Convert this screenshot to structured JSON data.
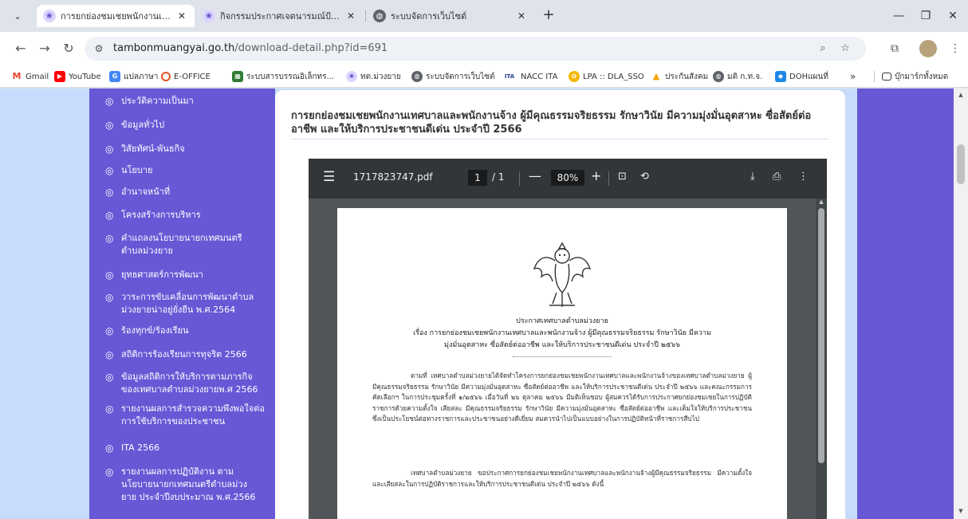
{
  "browser": {
    "tabs": [
      {
        "title": "การยกย่องชมเชยพนักงานเทศบาลและ",
        "active": true,
        "favicon": "seal-icon"
      },
      {
        "title": "กิจกรรมประกาศเจตนารมณ์ป้องกันแล",
        "active": false,
        "favicon": "seal-icon"
      },
      {
        "title": "ระบบจัดการเว็บไซต์",
        "active": false,
        "favicon": "globe-icon"
      }
    ],
    "url_domain": "tambonmuangyai.go.th",
    "url_path": "/download-detail.php?id=691",
    "bookmarks": [
      {
        "label": "Gmail",
        "icon": "gmail-icon"
      },
      {
        "label": "YouTube",
        "icon": "youtube-icon"
      },
      {
        "label": "แปลภาษา",
        "icon": "translate-icon"
      },
      {
        "label": "E-OFFICE",
        "icon": "ring-icon"
      },
      {
        "label": "ระบบสารบรรณอิเล็กทร...",
        "icon": "saraban-icon"
      },
      {
        "label": "ทต.ม่วงยาย",
        "icon": "seal-icon"
      },
      {
        "label": "ระบบจัดการเว็บไซต์",
        "icon": "globe-icon"
      },
      {
        "label": "NACC ITA",
        "icon": "ita-icon"
      },
      {
        "label": "LPA :: DLA_SSO",
        "icon": "lpa-icon"
      },
      {
        "label": "ประกันสังคม",
        "icon": "sso-icon"
      },
      {
        "label": "มติ ก.ท.จ.",
        "icon": "globe-icon"
      },
      {
        "label": "DOHแผนที่",
        "icon": "doh-icon"
      }
    ],
    "bookmarks_overflow": "»",
    "all_bookmarks": "บุ๊กมาร์กทั้งหมด"
  },
  "sidebar": {
    "items": [
      {
        "label": "ประวัติความเป็นมา"
      },
      {
        "label": "ข้อมูลทั่วไป"
      },
      {
        "label": "วิสัยทัศน์-พันธกิจ"
      },
      {
        "label": "นโยบาย"
      },
      {
        "label": "อำนาจหน้าที่"
      },
      {
        "label": "โครงสร้างการบริหาร"
      },
      {
        "label": "คำแถลงนโยบายนายกเทศมนตรีตำบลม่วงยาย"
      },
      {
        "label": "ยุทธศาสตร์การพัฒนา"
      },
      {
        "label": "วาระการขับเคลื่อนการพัฒนาตำบลม่วงยายน่าอยู่ยั่งยืน พ.ศ.2564"
      },
      {
        "label": "ร้องทุกข์/ร้องเรียน"
      },
      {
        "label": "สถิติการร้องเรียนการทุจริต 2566"
      },
      {
        "label": "ข้อมูลสถิติการให้บริการตามภารกิจของเทศบาลตำบลม่วงยายพ.ศ 2566"
      },
      {
        "label": "รายงานผลการสำรวจความพึงพอใจต่อการใช้บริการของประชาชน"
      },
      {
        "label": "ITA 2566"
      },
      {
        "label": "รายงานผลการปฏิบัติงาน ตามนโยบายนายกเทศมนตรีตำบลม่วงยาย ประจำปีงบประมาณ พ.ศ.2566"
      }
    ]
  },
  "content": {
    "title": "การยกย่องชมเชยพนักงานเทศบาลและพนักงานจ้าง ผู้มีคุณธรรมจริยธรรม รักษาวินัย มีความมุ่งมั่นอุตสาหะ ซื่อสัตย์ต่ออาชีพ และให้บริการประชาชนดีเด่น ประจำปี 2566"
  },
  "pdf": {
    "filename": "1717823747.pdf",
    "page_current": "1",
    "page_total": "/ 1",
    "zoom": "80%",
    "doc": {
      "issuer": "ประกาศเทศบาลตำบลม่วงยาย",
      "subject_line1": "เรื่อง  การยกย่องชมเชยพนักงานเทศบาลและพนักงานจ้าง ผู้มีคุณธรรมจริยธรรม รักษาวินัย มีความ",
      "subject_line2": "มุ่งมั่นอุตสาหะ ซื่อสัตย์ต่ออาชีพ และให้บริการประชาชนดีเด่น ประจำปี ๒๕๖๖",
      "para1": "ตามที่ เทศบาลตำบลม่วงยายได้จัดทำโครงการยกย่องชมเชยพนักงานเทศบาลและพนักงานจ้างของเทศบาลตำบลม่วงยาย ผู้มีคุณธรรมจริยธรรม รักษาวินัย มีความมุ่งมั่นอุตสาหะ ซื่อสัตย์ต่ออาชีพ และให้บริการประชาชนดีเด่น ประจำปี ๒๕๖๖ และคณะกรรมการคัดเลือกฯ ในการประชุมครั้งที่ ๑/๒๕๖๖ เมื่อวันที่ ๒๖ ตุลาคม ๒๕๖๖ มีมติเห็นชอบ ผู้สมควรได้รับการประกาศยกย่องชมเชยในการปฏิบัติราชการด้วยความตั้งใจ เสียสละ มีคุณธรรมจริยธรรม รักษาวินัย มีความมุ่งมั่นอุตสาหะ ซื่อสัตย์ต่ออาชีพ และเต็มใจให้บริการประชาชน ซึ่งเป็นประโยชน์ต่อทางราชการและประชาชนอย่างดีเยี่ยม สมควรนำไปเป็นแบบอย่างในการปฏิบัติหน้าที่ราชการสืบไป",
      "para2": "เทศบาลตำบลม่วงยาย ขอประกาศการยกย่องชมเชยพนักงานเทศบาลและพนักงานจ้างผู้มีคุณธรรมจริยธรรม มีความตั้งใจ และเสียสละในการปฏิบัติราชการและให้บริการประชาชนดีเด่น ประจำปี ๒๕๖๖ ดังนี้"
    }
  },
  "colors": {
    "sidebar_bg": "#6758d6",
    "page_bg": "#c6dcfa",
    "pdf_toolbar": "#323639",
    "pdf_bg": "#525659"
  }
}
